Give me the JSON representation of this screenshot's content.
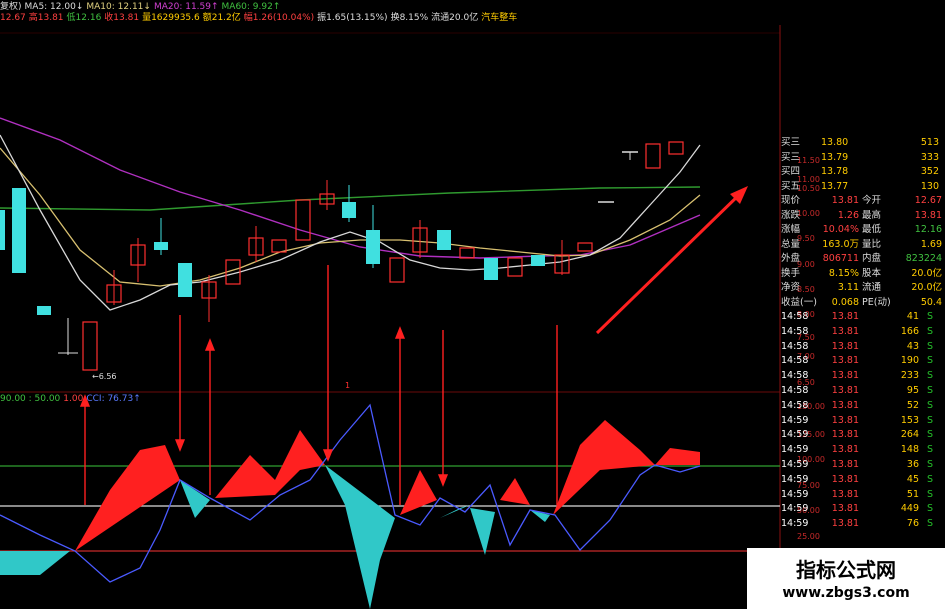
{
  "header": {
    "row1": [
      {
        "text": "复权)",
        "color": "#dddddd"
      },
      {
        "text": "MA5: 12.00↓",
        "color": "#dddddd"
      },
      {
        "text": "MA10: 12.11↓",
        "color": "#e0d080"
      },
      {
        "text": "MA20: 11.59↑",
        "color": "#d040d0"
      },
      {
        "text": "MA60: 9.92↑",
        "color": "#40c040"
      }
    ],
    "row2": [
      {
        "text": "12.67",
        "color": "#ff4040"
      },
      {
        "text": "高13.81",
        "color": "#ff4040"
      },
      {
        "text": "低12.16",
        "color": "#40c040"
      },
      {
        "text": "收13.81",
        "color": "#ff4040"
      },
      {
        "text": "量1629935.6",
        "color": "#ffcc00"
      },
      {
        "text": "额21.2亿",
        "color": "#ffcc00"
      },
      {
        "text": "幅1.26(10.04%)",
        "color": "#ff4040"
      },
      {
        "text": "振1.65(13.15%)",
        "color": "#dddddd"
      },
      {
        "text": "换8.15%",
        "color": "#dddddd"
      },
      {
        "text": "流通20.0亿",
        "color": "#dddddd"
      },
      {
        "text": "汽车整车",
        "color": "#ffcc00"
      }
    ],
    "indicator": [
      {
        "text": "90.00 : 50.00",
        "color": "#40c040"
      },
      {
        "text": "1.00",
        "color": "#ff4040"
      },
      {
        "text": "CCI: 76.73↑",
        "color": "#5a7aff"
      }
    ]
  },
  "price_scale": [
    "11.50",
    "11.00",
    "10.50",
    "10.00",
    "9.50",
    "9.00",
    "8.50",
    "8.00",
    "7.50",
    "7.00",
    "6.50"
  ],
  "indicator_scale": [
    "150.00",
    "125.00",
    "100.00",
    "75.00",
    "50.00",
    "25.00"
  ],
  "low_label": "6.56",
  "mini_label": "1",
  "order_book": [
    {
      "label": "买三",
      "price": "13.80",
      "vol": "513"
    },
    {
      "label": "买三",
      "price": "13.79",
      "vol": "333"
    },
    {
      "label": "买四",
      "price": "13.78",
      "vol": "352"
    },
    {
      "label": "买五",
      "price": "13.77",
      "vol": "130"
    }
  ],
  "stats": [
    {
      "l1": "现价",
      "v1": "13.81",
      "v1c": "#ff4040",
      "l2": "今开",
      "v2": "12.67",
      "v2c": "#ff4040"
    },
    {
      "l1": "涨跌",
      "v1": "1.26",
      "v1c": "#ff4040",
      "l2": "最高",
      "v2": "13.81",
      "v2c": "#ff4040"
    },
    {
      "l1": "涨幅",
      "v1": "10.04%",
      "v1c": "#ff4040",
      "l2": "最低",
      "v2": "12.16",
      "v2c": "#40c040"
    },
    {
      "l1": "总量",
      "v1": "163.0万",
      "v1c": "#ffcc00",
      "l2": "量比",
      "v2": "1.69",
      "v2c": "#ffcc00"
    },
    {
      "l1": "外盘",
      "v1": "806711",
      "v1c": "#ff4040",
      "l2": "内盘",
      "v2": "823224",
      "v2c": "#40c040"
    },
    {
      "l1": "换手",
      "v1": "8.15%",
      "v1c": "#ffcc00",
      "l2": "股本",
      "v2": "20.0亿",
      "v2c": "#ffcc00"
    },
    {
      "l1": "净资",
      "v1": "3.11",
      "v1c": "#ffcc00",
      "l2": "流通",
      "v2": "20.0亿",
      "v2c": "#ffcc00"
    },
    {
      "l1": "收益(一)",
      "v1": "0.068",
      "v1c": "#ffcc00",
      "l2": "PE(动)",
      "v2": "50.4",
      "v2c": "#ffcc00"
    }
  ],
  "ticks": [
    {
      "time": "14:58",
      "price": "13.81",
      "vol": "41",
      "side": "S"
    },
    {
      "time": "14:58",
      "price": "13.81",
      "vol": "166",
      "side": "S"
    },
    {
      "time": "14:58",
      "price": "13.81",
      "vol": "43",
      "side": "S"
    },
    {
      "time": "14:58",
      "price": "13.81",
      "vol": "190",
      "side": "S"
    },
    {
      "time": "14:58",
      "price": "13.81",
      "vol": "233",
      "side": "S"
    },
    {
      "time": "14:58",
      "price": "13.81",
      "vol": "95",
      "side": "S"
    },
    {
      "time": "14:58",
      "price": "13.81",
      "vol": "52",
      "side": "S"
    },
    {
      "time": "14:59",
      "price": "13.81",
      "vol": "153",
      "side": "S"
    },
    {
      "time": "14:59",
      "price": "13.81",
      "vol": "264",
      "side": "S"
    },
    {
      "time": "14:59",
      "price": "13.81",
      "vol": "148",
      "side": "S"
    },
    {
      "time": "14:59",
      "price": "13.81",
      "vol": "36",
      "side": "S"
    },
    {
      "time": "14:59",
      "price": "13.81",
      "vol": "45",
      "side": "S"
    },
    {
      "time": "14:59",
      "price": "13.81",
      "vol": "51",
      "side": "S"
    },
    {
      "time": "14:59",
      "price": "13.81",
      "vol": "449",
      "side": "S"
    },
    {
      "time": "14:59",
      "price": "13.81",
      "vol": "76",
      "side": "S"
    }
  ],
  "watermark": {
    "cn": "指标公式网",
    "url": "www.zbgs3.com"
  },
  "colors": {
    "up": "#ff3030",
    "down": "#40e0e0",
    "grid": "#8a1010",
    "ma60": "#30a030",
    "ma20": "#b030c0",
    "ma10": "#d8c070",
    "ma5": "#dddddd",
    "cci": "#4a5aff",
    "arrow": "#ff2020"
  }
}
